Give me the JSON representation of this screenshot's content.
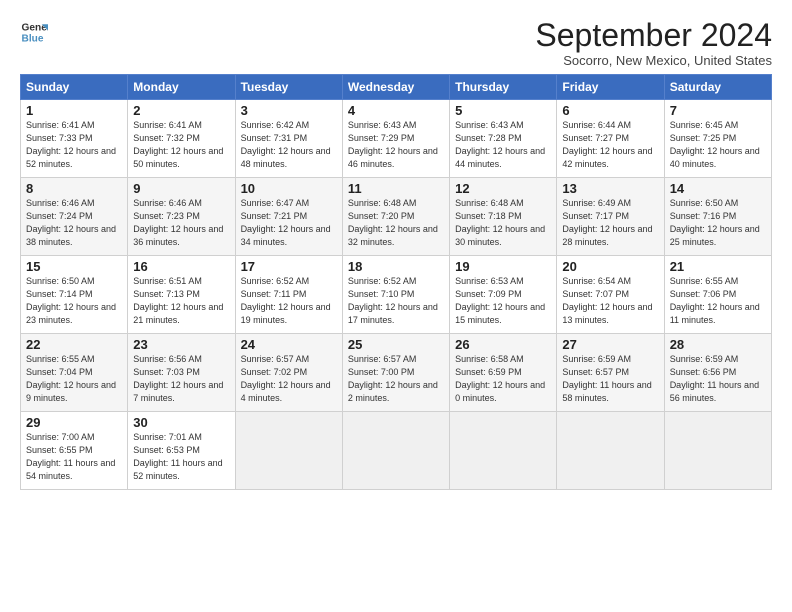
{
  "logo": {
    "line1": "General",
    "line2": "Blue"
  },
  "title": "September 2024",
  "subtitle": "Socorro, New Mexico, United States",
  "weekdays": [
    "Sunday",
    "Monday",
    "Tuesday",
    "Wednesday",
    "Thursday",
    "Friday",
    "Saturday"
  ],
  "weeks": [
    [
      {
        "day": "1",
        "rise": "6:41 AM",
        "set": "7:33 PM",
        "daylight": "12 hours and 52 minutes."
      },
      {
        "day": "2",
        "rise": "6:41 AM",
        "set": "7:32 PM",
        "daylight": "12 hours and 50 minutes."
      },
      {
        "day": "3",
        "rise": "6:42 AM",
        "set": "7:31 PM",
        "daylight": "12 hours and 48 minutes."
      },
      {
        "day": "4",
        "rise": "6:43 AM",
        "set": "7:29 PM",
        "daylight": "12 hours and 46 minutes."
      },
      {
        "day": "5",
        "rise": "6:43 AM",
        "set": "7:28 PM",
        "daylight": "12 hours and 44 minutes."
      },
      {
        "day": "6",
        "rise": "6:44 AM",
        "set": "7:27 PM",
        "daylight": "12 hours and 42 minutes."
      },
      {
        "day": "7",
        "rise": "6:45 AM",
        "set": "7:25 PM",
        "daylight": "12 hours and 40 minutes."
      }
    ],
    [
      {
        "day": "8",
        "rise": "6:46 AM",
        "set": "7:24 PM",
        "daylight": "12 hours and 38 minutes."
      },
      {
        "day": "9",
        "rise": "6:46 AM",
        "set": "7:23 PM",
        "daylight": "12 hours and 36 minutes."
      },
      {
        "day": "10",
        "rise": "6:47 AM",
        "set": "7:21 PM",
        "daylight": "12 hours and 34 minutes."
      },
      {
        "day": "11",
        "rise": "6:48 AM",
        "set": "7:20 PM",
        "daylight": "12 hours and 32 minutes."
      },
      {
        "day": "12",
        "rise": "6:48 AM",
        "set": "7:18 PM",
        "daylight": "12 hours and 30 minutes."
      },
      {
        "day": "13",
        "rise": "6:49 AM",
        "set": "7:17 PM",
        "daylight": "12 hours and 28 minutes."
      },
      {
        "day": "14",
        "rise": "6:50 AM",
        "set": "7:16 PM",
        "daylight": "12 hours and 25 minutes."
      }
    ],
    [
      {
        "day": "15",
        "rise": "6:50 AM",
        "set": "7:14 PM",
        "daylight": "12 hours and 23 minutes."
      },
      {
        "day": "16",
        "rise": "6:51 AM",
        "set": "7:13 PM",
        "daylight": "12 hours and 21 minutes."
      },
      {
        "day": "17",
        "rise": "6:52 AM",
        "set": "7:11 PM",
        "daylight": "12 hours and 19 minutes."
      },
      {
        "day": "18",
        "rise": "6:52 AM",
        "set": "7:10 PM",
        "daylight": "12 hours and 17 minutes."
      },
      {
        "day": "19",
        "rise": "6:53 AM",
        "set": "7:09 PM",
        "daylight": "12 hours and 15 minutes."
      },
      {
        "day": "20",
        "rise": "6:54 AM",
        "set": "7:07 PM",
        "daylight": "12 hours and 13 minutes."
      },
      {
        "day": "21",
        "rise": "6:55 AM",
        "set": "7:06 PM",
        "daylight": "12 hours and 11 minutes."
      }
    ],
    [
      {
        "day": "22",
        "rise": "6:55 AM",
        "set": "7:04 PM",
        "daylight": "12 hours and 9 minutes."
      },
      {
        "day": "23",
        "rise": "6:56 AM",
        "set": "7:03 PM",
        "daylight": "12 hours and 7 minutes."
      },
      {
        "day": "24",
        "rise": "6:57 AM",
        "set": "7:02 PM",
        "daylight": "12 hours and 4 minutes."
      },
      {
        "day": "25",
        "rise": "6:57 AM",
        "set": "7:00 PM",
        "daylight": "12 hours and 2 minutes."
      },
      {
        "day": "26",
        "rise": "6:58 AM",
        "set": "6:59 PM",
        "daylight": "12 hours and 0 minutes."
      },
      {
        "day": "27",
        "rise": "6:59 AM",
        "set": "6:57 PM",
        "daylight": "11 hours and 58 minutes."
      },
      {
        "day": "28",
        "rise": "6:59 AM",
        "set": "6:56 PM",
        "daylight": "11 hours and 56 minutes."
      }
    ],
    [
      {
        "day": "29",
        "rise": "7:00 AM",
        "set": "6:55 PM",
        "daylight": "11 hours and 54 minutes."
      },
      {
        "day": "30",
        "rise": "7:01 AM",
        "set": "6:53 PM",
        "daylight": "11 hours and 52 minutes."
      },
      null,
      null,
      null,
      null,
      null
    ]
  ],
  "labels": {
    "sunrise": "Sunrise:",
    "sunset": "Sunset:",
    "daylight": "Daylight:"
  }
}
